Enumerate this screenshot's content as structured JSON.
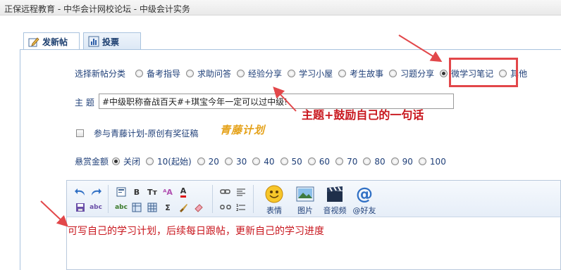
{
  "window": {
    "title": "正保远程教育 - 中华会计网校论坛 - 中级会计实务"
  },
  "tabs": [
    {
      "label": "发新帖",
      "active": true
    },
    {
      "label": "投票",
      "active": false
    }
  ],
  "category": {
    "label": "选择新帖分类",
    "options": [
      "备考指导",
      "求助问答",
      "经验分享",
      "学习小屋",
      "考生故事",
      "习题分享",
      "微学习笔记",
      "其他"
    ],
    "selected": "微学习笔记"
  },
  "subject": {
    "label": "主 题",
    "value": "#中级职称奋战百天#+琪宝今年一定可以过中级!"
  },
  "contest": {
    "label": "参与青藤计划-原创有奖征稿",
    "brand": "青藤计划"
  },
  "reward": {
    "label": "悬赏金额",
    "options": [
      "关闭",
      "10(起始)",
      "20",
      "30",
      "40",
      "50",
      "60",
      "70",
      "80",
      "90",
      "100"
    ],
    "selected": "关闭"
  },
  "toolbar": {
    "buttons": [
      "undo-icon",
      "redo-icon",
      "code-icon",
      "bold-icon",
      "text-size-icon",
      "font-icon",
      "font-color-icon",
      "save-icon",
      "spellcheck-icon",
      "spellcheck-abc-icon",
      "table-icon",
      "table-grid-icon",
      "sum-icon",
      "brush-icon",
      "eraser-icon",
      "link-icon",
      "unlink-icon",
      "align-icon",
      "list-icon"
    ],
    "emoji_label": "表情",
    "image_label": "图片",
    "media_label": "音视频",
    "friend_label": "@好友"
  },
  "annotations": {
    "subject_hint": "主题+鼓励自己的一句话",
    "body_hint": "可写自己的学习计划，后续每日跟帖，更新自己的学习进度"
  },
  "colors": {
    "annotation_red": "#c8161d",
    "link_blue": "#1f3f78",
    "brand_orange": "#e5a21a"
  }
}
